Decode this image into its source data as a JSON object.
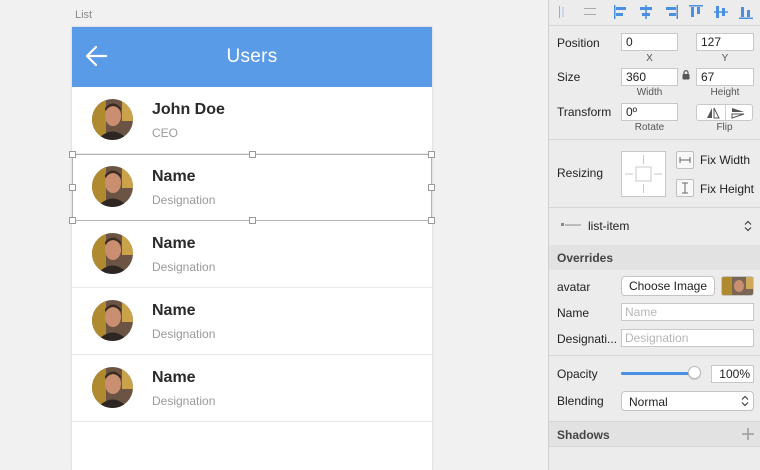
{
  "canvas": {
    "artboard_label": "List",
    "app_bar": {
      "title": "Users",
      "back_icon": "arrow-left-icon",
      "color": "#5a9be8"
    },
    "list_items": [
      {
        "name": "John Doe",
        "designation": "CEO"
      },
      {
        "name": "Name",
        "designation": "Designation"
      },
      {
        "name": "Name",
        "designation": "Designation"
      },
      {
        "name": "Name",
        "designation": "Designation"
      },
      {
        "name": "Name",
        "designation": "Designation"
      }
    ]
  },
  "inspector": {
    "align_icons": [
      "align-left-icon",
      "distribute-horizontal-icon",
      "align-left-edges-icon",
      "align-horizontal-center-icon",
      "align-right-edges-icon",
      "align-top-edges-icon",
      "align-vertical-center-icon",
      "align-bottom-edges-icon"
    ],
    "position": {
      "label": "Position",
      "x": "0",
      "y": "127",
      "x_label": "X",
      "y_label": "Y"
    },
    "size": {
      "label": "Size",
      "width": "360",
      "height": "67",
      "width_label": "Width",
      "height_label": "Height"
    },
    "transform": {
      "label": "Transform",
      "rotate": "0º",
      "rotate_label": "Rotate",
      "flip_label": "Flip"
    },
    "resizing": {
      "label": "Resizing",
      "fix_width": "Fix Width",
      "fix_height": "Fix Height"
    },
    "symbol": {
      "name": "list-item"
    },
    "overrides": {
      "title": "Overrides",
      "avatar_label": "avatar",
      "choose_image": "Choose Image",
      "name_label": "Name",
      "name_placeholder": "Name",
      "designation_label": "Designati...",
      "designation_placeholder": "Designation"
    },
    "opacity": {
      "label": "Opacity",
      "value": "100%",
      "level": 1.0
    },
    "blending": {
      "label": "Blending",
      "value": "Normal"
    },
    "shadows": {
      "title": "Shadows"
    },
    "accent_color": "#4a90e2"
  }
}
